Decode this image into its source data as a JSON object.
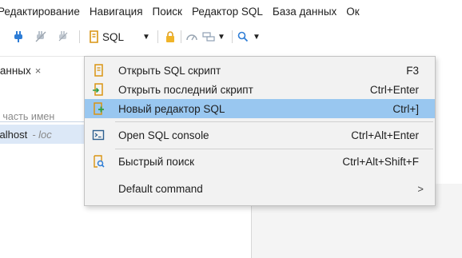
{
  "menubar": {
    "items": [
      {
        "label": "Редактирование"
      },
      {
        "label": "Навигация"
      },
      {
        "label": "Поиск"
      },
      {
        "label": "Редактор SQL"
      },
      {
        "label": "База данных"
      },
      {
        "label": "Ок"
      }
    ]
  },
  "toolbar": {
    "sql_label": "SQL",
    "icons": [
      "plug-connect-icon",
      "plug-disconnect-icon",
      "plug-invalidate-icon",
      "sql-editor-icon",
      "lock-icon",
      "dashboard-icon",
      "database-transaction-icon",
      "search-icon"
    ]
  },
  "left_panel": {
    "tab_label": "данных",
    "tab_close": "×",
    "filter_placeholder": "е часть имен",
    "connection_name": "calhost",
    "connection_suffix": "- loc"
  },
  "sql_menu": {
    "items": [
      {
        "label": "Открыть SQL скрипт",
        "shortcut": "F3",
        "icon": "open-script-icon"
      },
      {
        "label": "Открыть последний скрипт",
        "shortcut": "Ctrl+Enter",
        "icon": "recent-script-icon"
      },
      {
        "label": "Новый редактор SQL",
        "shortcut": "Ctrl+]",
        "icon": "new-sql-editor-icon",
        "selected": true
      },
      {
        "label": "Open SQL console",
        "shortcut": "Ctrl+Alt+Enter",
        "icon": "sql-console-icon"
      },
      {
        "label": "Быстрый поиск",
        "shortcut": "Ctrl+Alt+Shift+F",
        "icon": "quick-search-icon"
      },
      {
        "label": "Default command",
        "shortcut": "",
        "submenu_arrow": ">"
      }
    ]
  },
  "colors": {
    "selection": "#99c7f0",
    "connection_highlight": "#dce8f7",
    "menu_background": "#f2f2f2",
    "connect_icon": "#2e7dd6",
    "lock_icon": "#f0b429",
    "search_icon": "#2e7dd6"
  }
}
